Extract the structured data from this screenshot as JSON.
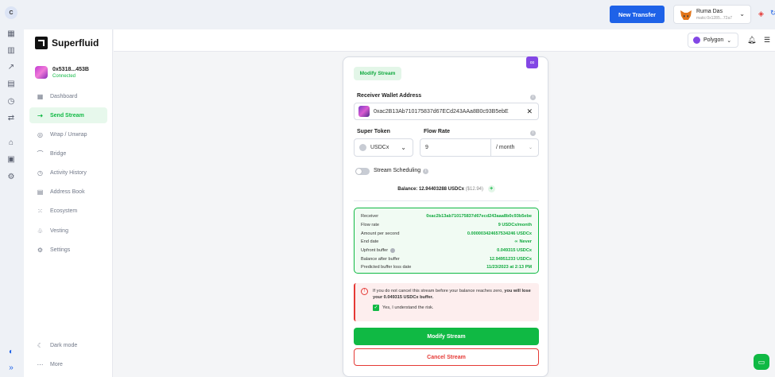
{
  "topbar": {
    "profile_initial": "C",
    "new_transfer_label": "New Transfer",
    "account_name": "Ruma Das",
    "account_address": "matic:0x1285...72a7"
  },
  "rail_icons": [
    "apps-icon",
    "chart-icon",
    "line-chart-icon",
    "document-icon",
    "history-icon",
    "swap-icon",
    "bank-icon",
    "contacts-icon",
    "settings-icon"
  ],
  "sidebar": {
    "logo": "Superfluid",
    "wallet_address": "0x5318...453B",
    "wallet_status": "Connected",
    "items": [
      {
        "label": "Dashboard",
        "icon": "dashboard-icon"
      },
      {
        "label": "Send Stream",
        "icon": "send-icon",
        "active": true
      },
      {
        "label": "Wrap / Unwrap",
        "icon": "wrap-icon"
      },
      {
        "label": "Bridge",
        "icon": "bridge-icon"
      },
      {
        "label": "Activity History",
        "icon": "history-icon"
      },
      {
        "label": "Address Book",
        "icon": "address-book-icon"
      },
      {
        "label": "Ecosystem",
        "icon": "grid-icon"
      },
      {
        "label": "Vesting",
        "icon": "vesting-icon"
      },
      {
        "label": "Settings",
        "icon": "gear-icon"
      }
    ],
    "dark_mode_label": "Dark mode",
    "more_label": "More"
  },
  "header": {
    "network": "Polygon"
  },
  "form": {
    "badge": "Modify Stream",
    "receiver_label": "Receiver Wallet Address",
    "receiver_value": "0xac2B13Ab710175837d67ECd243AAa8B0c93B5ebE",
    "super_token_label": "Super Token",
    "super_token_value": "USDCx",
    "flow_rate_label": "Flow Rate",
    "flow_rate_value": "9",
    "flow_rate_unit": "/ month",
    "scheduling_label": "Stream Scheduling",
    "balance_text": "Balance: 12.94403288 USDCx",
    "balance_fiat": "($12.94)"
  },
  "summary": [
    {
      "key": "Receiver",
      "value": "0xac2b13ab710175837d67ecd243aaa8b0c93b5ebe"
    },
    {
      "key": "Flow rate",
      "value": "9 USDCx/month"
    },
    {
      "key": "Amount per second",
      "value": "0.000003424657534246 USDCx"
    },
    {
      "key": "End date",
      "value": "Never",
      "icon": "infinity-icon"
    },
    {
      "key": "Upfront buffer",
      "value": "0.049315 USDCx",
      "info": true
    },
    {
      "key": "Balance after buffer",
      "value": "12.94951233 USDCx"
    },
    {
      "key": "Predicted buffer loss date",
      "value": "11/23/2023 at 2:13 PM"
    }
  ],
  "warning": {
    "text_start": "If you do not cancel this stream before your balance reaches zero, ",
    "text_bold": "you will lose your 0.049315 USDCx buffer.",
    "ack_label": "Yes, I understand the risk."
  },
  "buttons": {
    "modify": "Modify Stream",
    "cancel": "Cancel Stream"
  },
  "colors": {
    "accent_green": "#10b944",
    "primary_blue": "#1e62e8",
    "danger_red": "#e53935",
    "polygon_purple": "#8247e5"
  }
}
